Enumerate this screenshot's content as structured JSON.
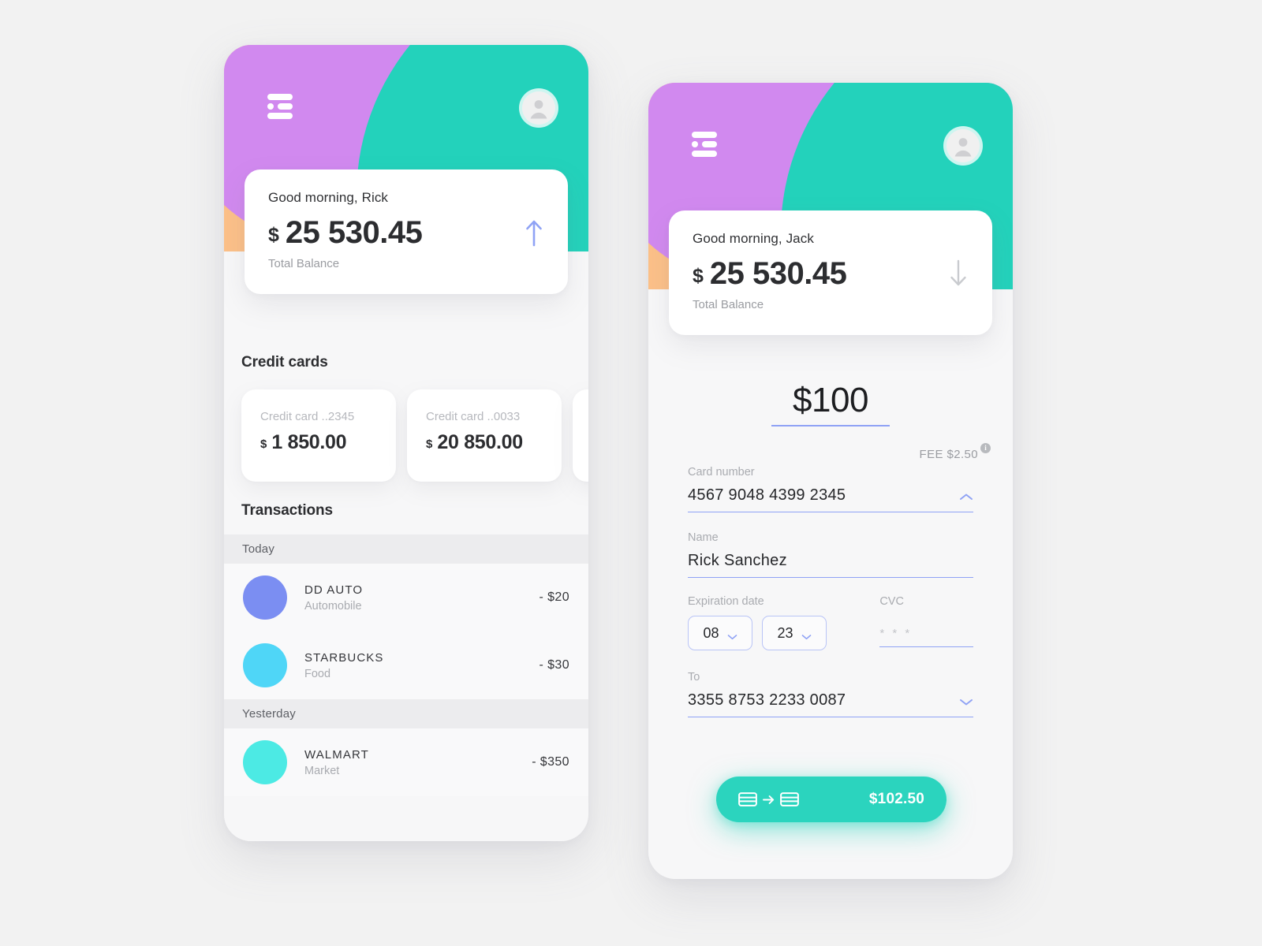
{
  "theme": {
    "purple": "#d189ef",
    "orange": "#fcc088",
    "teal": "#23d2bb",
    "accent_blue": "#8fa2f5",
    "button_teal": "#2bd4be",
    "page_bg": "#f2f2f2"
  },
  "left_screen": {
    "menu_icon": "hamburger-menu-icon",
    "avatar_icon": "user-avatar-icon",
    "balance": {
      "greeting": "Good morning, Rick",
      "currency": "$",
      "amount": "25 530.45",
      "label": "Total Balance",
      "trend_icon": "arrow-up-icon",
      "trend_direction": "up",
      "trend_color": "#8fa2f5"
    },
    "credit_cards": {
      "title": "Credit cards",
      "items": [
        {
          "label": "Credit card ..2345",
          "currency": "$",
          "amount": "1 850.00"
        },
        {
          "label": "Credit card ..0033",
          "currency": "$",
          "amount": "20 850.00"
        },
        {
          "label": "",
          "currency": "",
          "amount": ""
        }
      ]
    },
    "transactions": {
      "title": "Transactions",
      "groups": [
        {
          "day": "Today",
          "rows": [
            {
              "merchant": "DD AUTO",
              "category": "Automobile",
              "amount": "- $20",
              "dot_color": "#7b8ef2"
            },
            {
              "merchant": "STARBUCKS",
              "category": "Food",
              "amount": "- $30",
              "dot_color": "#4fd6f7"
            }
          ]
        },
        {
          "day": "Yesterday",
          "rows": [
            {
              "merchant": "WALMART",
              "category": "Market",
              "amount": "- $350",
              "dot_color": "#4ceae4"
            }
          ]
        }
      ]
    }
  },
  "right_screen": {
    "menu_icon": "hamburger-menu-icon",
    "avatar_icon": "user-avatar-icon",
    "balance": {
      "greeting": "Good morning, Jack",
      "currency": "$",
      "amount": "25 530.45",
      "label": "Total Balance",
      "trend_icon": "arrow-down-icon",
      "trend_direction": "down",
      "trend_color": "#c9cbcf"
    },
    "transfer_form": {
      "amount_value": "$100",
      "fee_text": "FEE $2.50",
      "fee_info_icon": "info-icon",
      "card_number_label": "Card number",
      "card_number_value": "4567 9048 4399 2345",
      "card_number_chevron": "chevron-up-icon",
      "name_label": "Name",
      "name_value": "Rick Sanchez",
      "expiration_label": "Expiration date",
      "expiration_month": "08",
      "expiration_year": "23",
      "expiration_chevron": "chevron-down-icon",
      "cvc_label": "CVC",
      "cvc_value": "* * *",
      "to_label": "To",
      "to_value": "3355 8753 2233 0087",
      "to_chevron": "chevron-down-icon",
      "submit_icon_from": "credit-card-icon",
      "submit_icon_arrow": "arrow-right-icon",
      "submit_icon_to": "credit-card-icon",
      "submit_total": "$102.50"
    }
  }
}
